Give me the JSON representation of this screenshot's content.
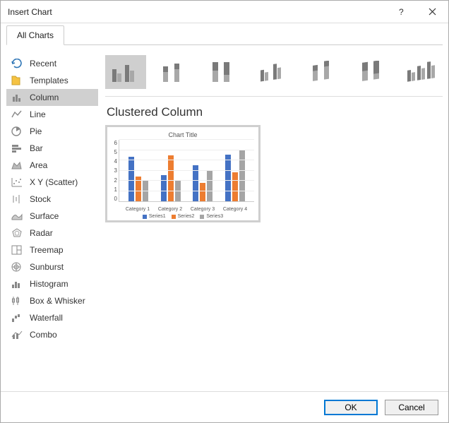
{
  "title": "Insert Chart",
  "tabs": {
    "all": "All Charts"
  },
  "sidebar": {
    "items": [
      {
        "label": "Recent"
      },
      {
        "label": "Templates"
      },
      {
        "label": "Column"
      },
      {
        "label": "Line"
      },
      {
        "label": "Pie"
      },
      {
        "label": "Bar"
      },
      {
        "label": "Area"
      },
      {
        "label": "X Y (Scatter)"
      },
      {
        "label": "Stock"
      },
      {
        "label": "Surface"
      },
      {
        "label": "Radar"
      },
      {
        "label": "Treemap"
      },
      {
        "label": "Sunburst"
      },
      {
        "label": "Histogram"
      },
      {
        "label": "Box & Whisker"
      },
      {
        "label": "Waterfall"
      },
      {
        "label": "Combo"
      }
    ]
  },
  "subtitle": "Clustered Column",
  "preview_title": "Chart Title",
  "buttons": {
    "ok": "OK",
    "cancel": "Cancel"
  },
  "chart_data": {
    "type": "bar",
    "title": "Chart Title",
    "xlabel": "",
    "ylabel": "",
    "ylim": [
      0,
      6
    ],
    "yticks": [
      0,
      1,
      2,
      3,
      4,
      5,
      6
    ],
    "categories": [
      "Category 1",
      "Category 2",
      "Category 3",
      "Category 4"
    ],
    "series": [
      {
        "name": "Series1",
        "values": [
          4.3,
          2.5,
          3.5,
          4.5
        ]
      },
      {
        "name": "Series2",
        "values": [
          2.4,
          4.4,
          1.8,
          2.8
        ]
      },
      {
        "name": "Series3",
        "values": [
          2.0,
          2.0,
          3.0,
          5.0
        ]
      }
    ],
    "colors": {
      "Series1": "#4472c4",
      "Series2": "#ed7d31",
      "Series3": "#a5a5a5"
    }
  }
}
